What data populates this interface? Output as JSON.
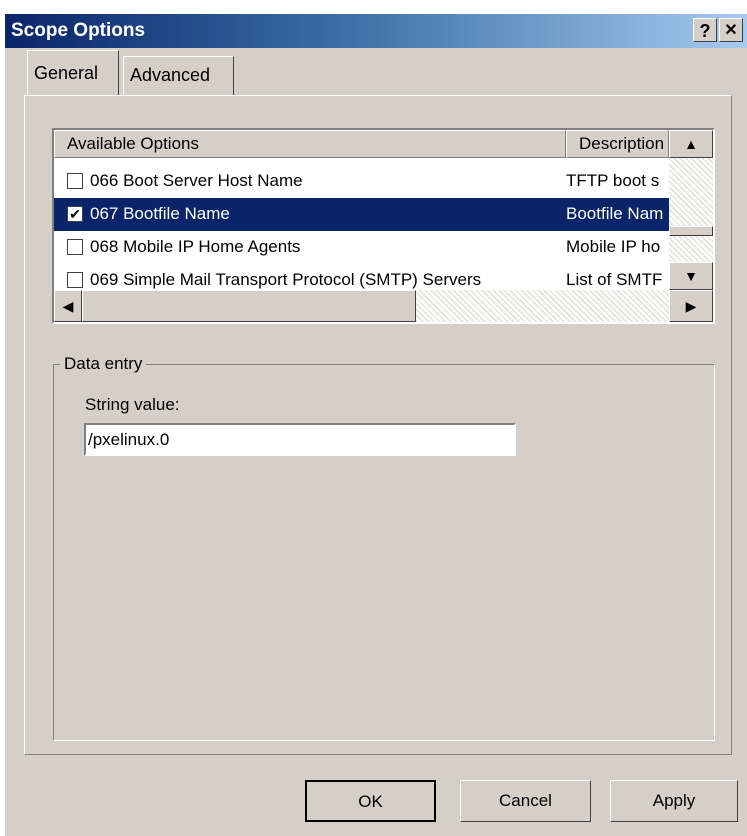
{
  "window": {
    "title": "Scope Options",
    "help_label": "?",
    "close_label": "✕"
  },
  "tabs": [
    {
      "label": "General",
      "active": true
    },
    {
      "label": "Advanced",
      "active": false
    }
  ],
  "options_list": {
    "columns": [
      "Available Options",
      "Description"
    ],
    "rows": [
      {
        "checked": false,
        "name": "066 Boot Server Host Name",
        "description": "TFTP boot s",
        "selected": false
      },
      {
        "checked": true,
        "name": "067 Bootfile Name",
        "description": "Bootfile Nam",
        "selected": true
      },
      {
        "checked": false,
        "name": "068 Mobile IP Home Agents",
        "description": "Mobile IP ho",
        "selected": false
      },
      {
        "checked": false,
        "name": "069 Simple Mail Transport Protocol (SMTP) Servers",
        "description": "List of SMTF",
        "selected": false
      }
    ],
    "check_mark": "✔"
  },
  "data_entry": {
    "group_label": "Data entry",
    "field_label": "String value:",
    "value": "/pxelinux.0"
  },
  "buttons": {
    "ok": "OK",
    "cancel": "Cancel",
    "apply": "Apply"
  },
  "icons": {
    "scroll_up": "▲",
    "scroll_down": "▼",
    "scroll_left": "◀",
    "scroll_right": "▶"
  }
}
